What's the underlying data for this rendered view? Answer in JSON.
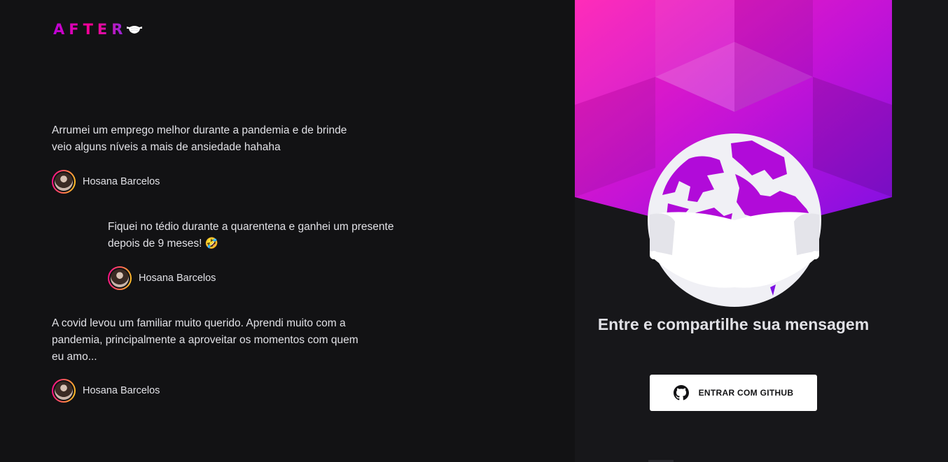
{
  "header": {
    "logo_text": "AFTER",
    "logo_icon": "face-mask-icon"
  },
  "messages": [
    {
      "text": "Arrumei um emprego melhor durante a pandemia e de brinde veio alguns níveis a mais de ansiedade hahaha",
      "author": "Hosana Barcelos"
    },
    {
      "text": "Fiquei no tédio durante a quarentena e ganhei um presente depois de 9 meses! 🤣",
      "author": "Hosana Barcelos"
    },
    {
      "text": "A covid levou um familiar muito querido. Aprendi muito com a pandemia, principalmente a aproveitar os momentos com quem eu amo...",
      "author": "Hosana Barcelos"
    }
  ],
  "login": {
    "title": "Entre e compartilhe sua mensagem",
    "button_label": "ENTRAR COM GITHUB",
    "button_icon": "github-icon"
  },
  "colors": {
    "background": "#121214",
    "accent_pink": "#ff008e",
    "accent_purple": "#8a2be2",
    "text": "#e1e1e6"
  }
}
